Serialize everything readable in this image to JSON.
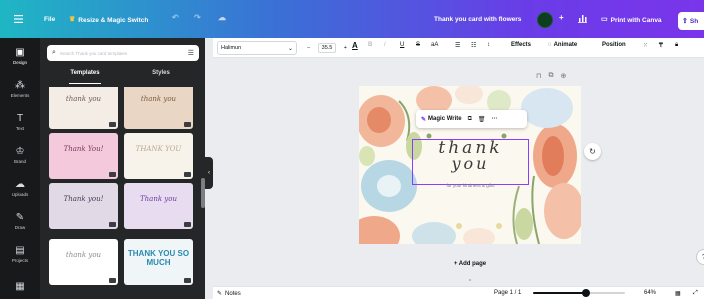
{
  "topbar": {
    "menu_icon": "hamburger-icon",
    "file_label": "File",
    "resize_label": "Resize & Magic Switch",
    "undo_icon": "undo-icon",
    "redo_icon": "redo-icon",
    "cloud_icon": "cloud-sync-icon",
    "doc_title": "Thank you card with flowers",
    "add_icon": "plus-icon",
    "analytics_icon": "bar-chart-icon",
    "print_label": "Print with Canva",
    "share_label": "Sh",
    "colors": {
      "gradient_start": "#1fb6c4",
      "gradient_end": "#7a35ea",
      "share_text": "#4b2bbf"
    }
  },
  "rail": {
    "items": [
      {
        "label": "Design",
        "icon": "design-icon"
      },
      {
        "label": "Elements",
        "icon": "elements-icon"
      },
      {
        "label": "Text",
        "icon": "text-icon"
      },
      {
        "label": "Brand",
        "icon": "brand-icon"
      },
      {
        "label": "Uploads",
        "icon": "upload-icon"
      },
      {
        "label": "Draw",
        "icon": "draw-icon"
      },
      {
        "label": "Projects",
        "icon": "projects-icon"
      },
      {
        "label": "Apps",
        "icon": "apps-icon"
      }
    ]
  },
  "panel": {
    "search_placeholder": "Search Thank you card templates",
    "tabs": [
      "Templates",
      "Styles"
    ],
    "templates": [
      {
        "title": "thank you",
        "bg": "#f4ede6",
        "color": "#6b5a50"
      },
      {
        "title": "thank you",
        "bg": "#e9d6c4",
        "color": "#7a5a40"
      },
      {
        "title": "Thank You!",
        "bg": "#f4c9dc",
        "color": "#7a3a5c"
      },
      {
        "title": "THANK YOU",
        "bg": "#f7f2ea",
        "color": "#b8a890"
      },
      {
        "title": "Thank you!",
        "bg": "#e2d9e6",
        "color": "#4a3a55"
      },
      {
        "title": "Thank you",
        "bg": "#e8ddf0",
        "color": "#6a3a9a"
      },
      {
        "title": "thank you",
        "bg": "#ffffff",
        "color": "#8a8a8a"
      },
      {
        "title": "THANK YOU SO MUCH",
        "bg": "#f0f6f8",
        "color": "#2a8ab0"
      }
    ]
  },
  "toolbar": {
    "font_name": "Halimun",
    "font_size": "35.5",
    "effects_label": "Effects",
    "animate_label": "Animate",
    "position_label": "Position"
  },
  "canvas": {
    "context_menu": {
      "magic_write_label": "Magic Write"
    },
    "card_line1": "thank",
    "card_line2": "you",
    "card_subtitle": "for your kindness & gifts",
    "add_page_label": "+ Add page"
  },
  "bottombar": {
    "notes_label": "Notes",
    "page_indicator": "Page 1 / 1",
    "zoom_label": "64%",
    "zoom_fraction": 0.58
  }
}
